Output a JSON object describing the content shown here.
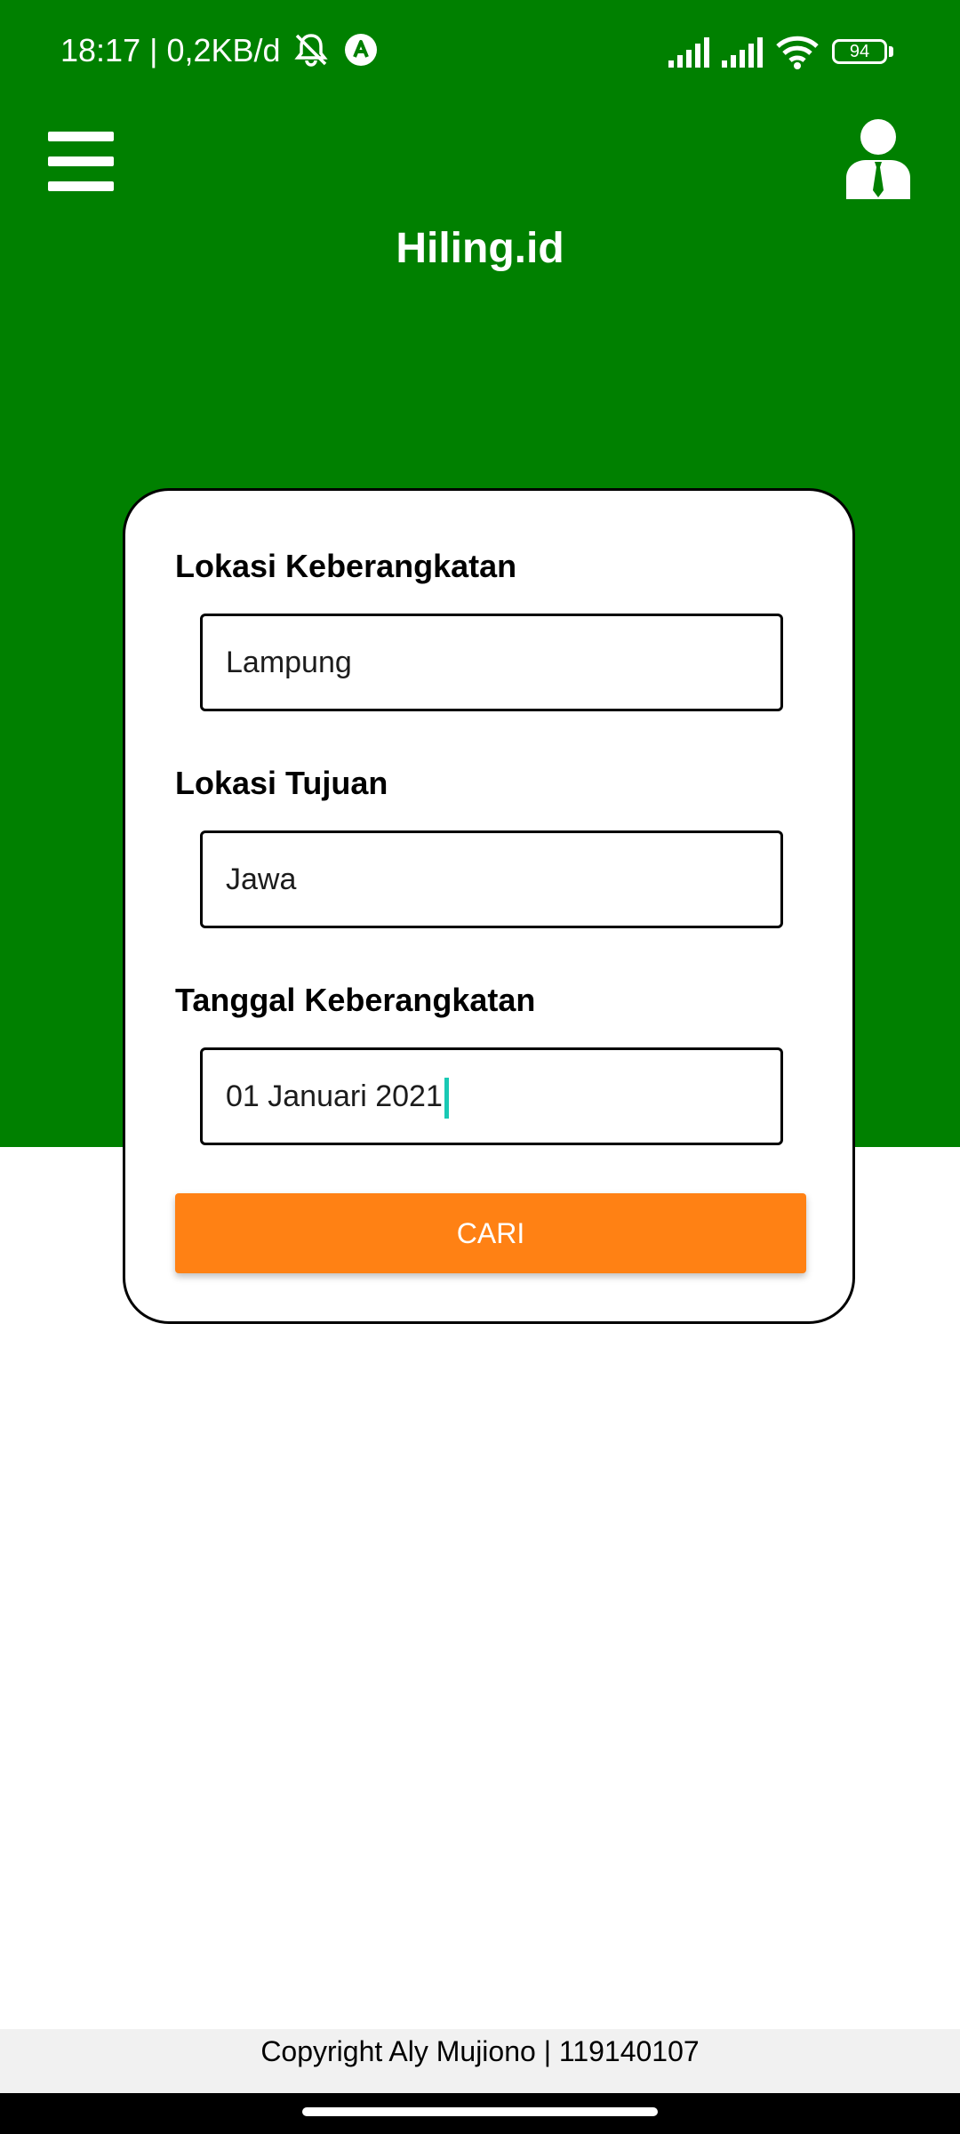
{
  "status_bar": {
    "time_and_speed": "18:17 | 0,2KB/d",
    "battery_level": "94",
    "icons": [
      "bell-off-icon",
      "app-notification-icon",
      "signal-icon",
      "signal-icon",
      "wifi-icon",
      "battery-icon"
    ]
  },
  "app_bar": {
    "title": "Hiling.id",
    "menu_icon": "hamburger-menu-icon",
    "profile_icon": "user-profile-icon"
  },
  "form": {
    "departure": {
      "label": "Lokasi Keberangkatan",
      "value": "Lampung"
    },
    "destination": {
      "label": "Lokasi Tujuan",
      "value": "Jawa"
    },
    "date": {
      "label": "Tanggal Keberangkatan",
      "value": "01 Januari 2021"
    },
    "search_button": "CARI"
  },
  "footer": {
    "text": "Copyright Aly Mujiono | 119140107"
  },
  "colors": {
    "primary_green": "#008000",
    "button_orange": "#ff8114",
    "caret_teal": "#19c9b4"
  }
}
